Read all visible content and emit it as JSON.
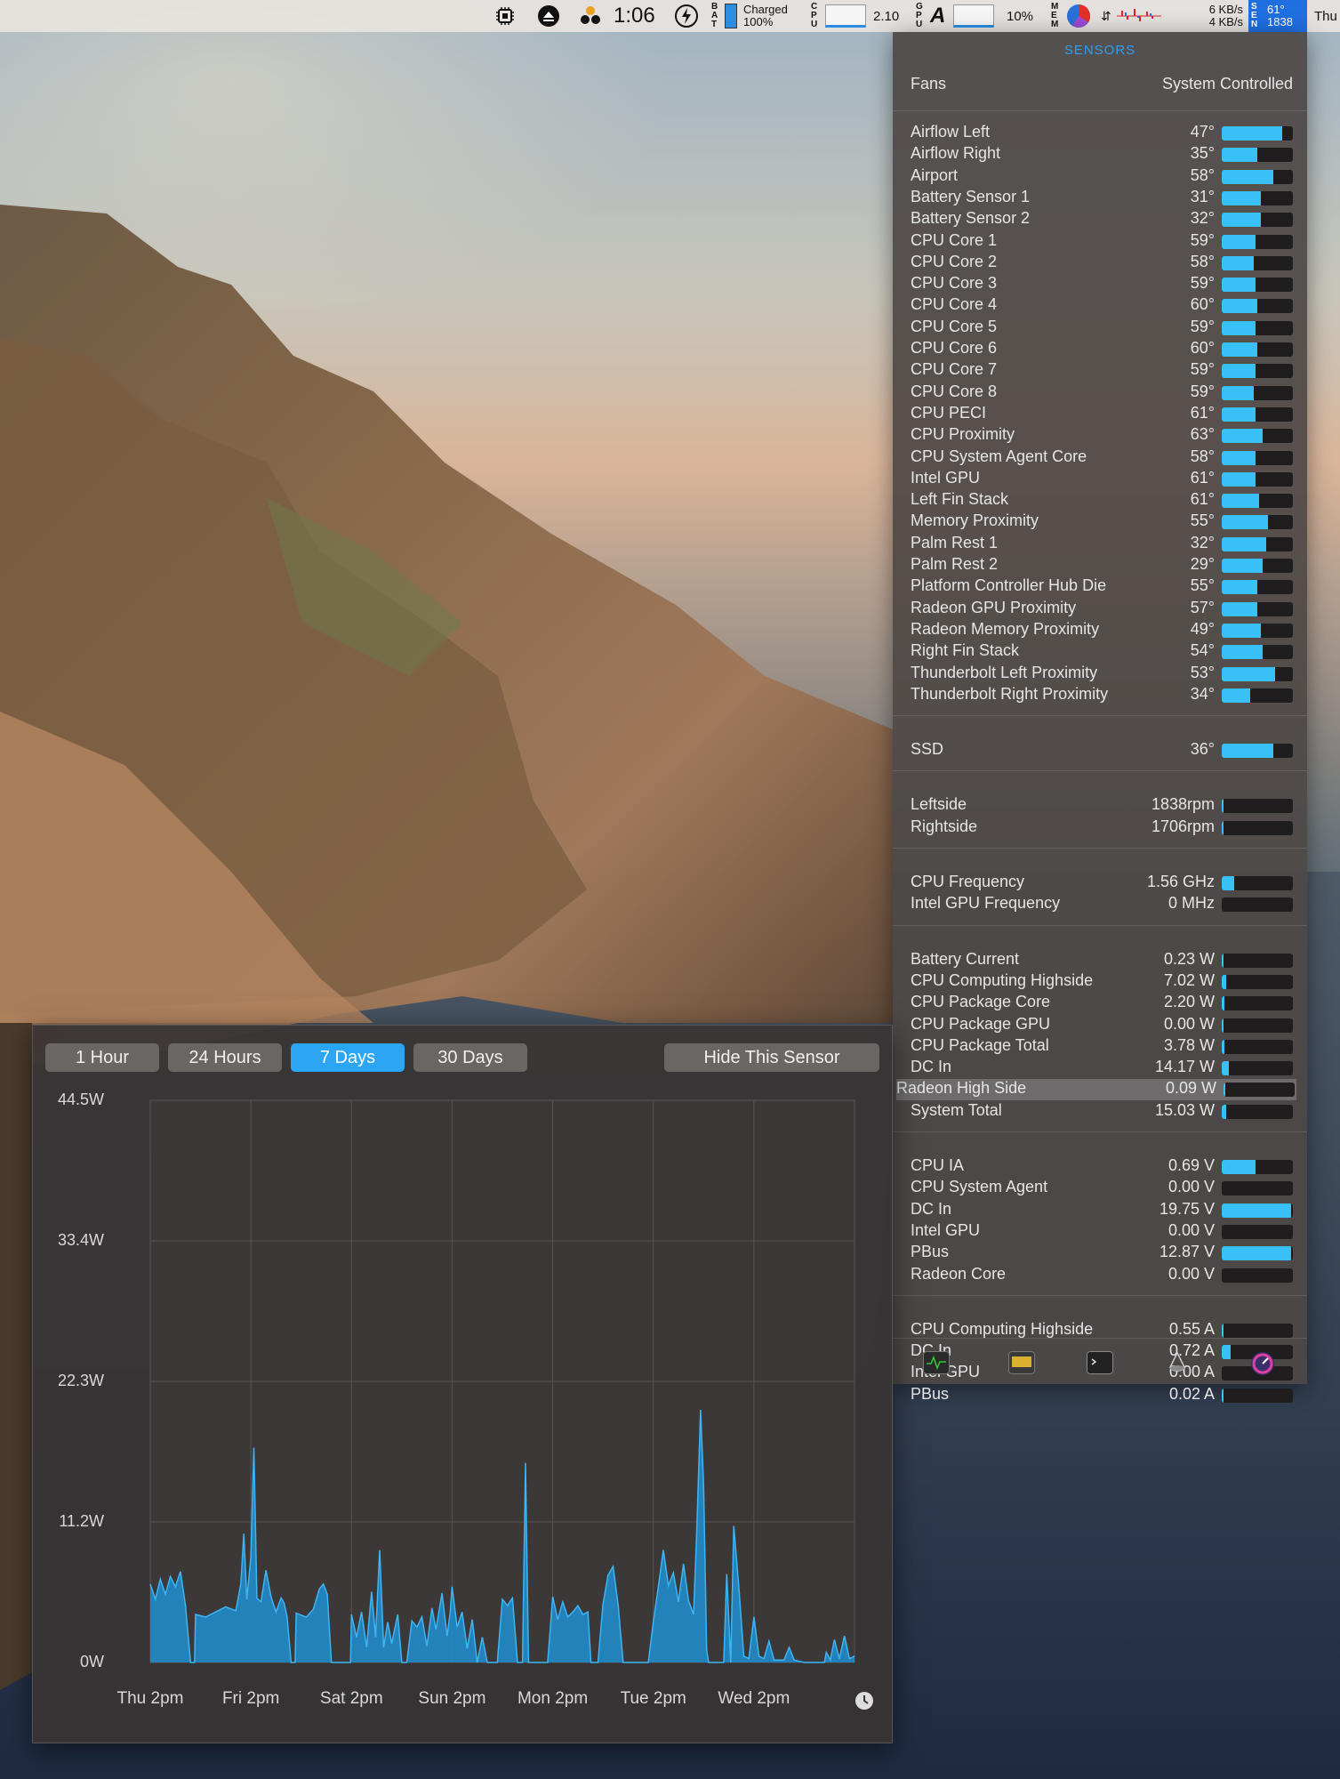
{
  "menubar": {
    "time": "1:06",
    "battery_label": "BAT",
    "battery_status": "Charged",
    "battery_percent": "100%",
    "cpu_label": "CPU",
    "cpu_load": "2.10",
    "gpu_label": "GPU",
    "gpu_percent": "10%",
    "mem_label": "MEM",
    "net_up": "6 KB/s",
    "net_down": "4 KB/s",
    "sensor_label": "SEN",
    "sensor_temp": "61°",
    "sensor_rpm": "1838",
    "day": "Thu"
  },
  "panel": {
    "title": "SENSORS",
    "fans_label": "Fans",
    "fans_mode": "System Controlled",
    "temperatures": [
      {
        "label": "Airflow Left",
        "value": "47°",
        "level": 0.85
      },
      {
        "label": "Airflow Right",
        "value": "35°",
        "level": 0.5
      },
      {
        "label": "Airport",
        "value": "58°",
        "level": 0.72
      },
      {
        "label": "Battery Sensor 1",
        "value": "31°",
        "level": 0.55
      },
      {
        "label": "Battery Sensor 2",
        "value": "32°",
        "level": 0.55
      },
      {
        "label": "CPU Core 1",
        "value": "59°",
        "level": 0.48
      },
      {
        "label": "CPU Core 2",
        "value": "58°",
        "level": 0.45
      },
      {
        "label": "CPU Core 3",
        "value": "59°",
        "level": 0.48
      },
      {
        "label": "CPU Core 4",
        "value": "60°",
        "level": 0.5
      },
      {
        "label": "CPU Core 5",
        "value": "59°",
        "level": 0.48
      },
      {
        "label": "CPU Core 6",
        "value": "60°",
        "level": 0.5
      },
      {
        "label": "CPU Core 7",
        "value": "59°",
        "level": 0.48
      },
      {
        "label": "CPU Core 8",
        "value": "59°",
        "level": 0.45
      },
      {
        "label": "CPU PECI",
        "value": "61°",
        "level": 0.48
      },
      {
        "label": "CPU Proximity",
        "value": "63°",
        "level": 0.58
      },
      {
        "label": "CPU System Agent Core",
        "value": "58°",
        "level": 0.48
      },
      {
        "label": "Intel GPU",
        "value": "61°",
        "level": 0.48
      },
      {
        "label": "Left Fin Stack",
        "value": "61°",
        "level": 0.52
      },
      {
        "label": "Memory Proximity",
        "value": "55°",
        "level": 0.65
      },
      {
        "label": "Palm Rest 1",
        "value": "32°",
        "level": 0.62
      },
      {
        "label": "Palm Rest 2",
        "value": "29°",
        "level": 0.58
      },
      {
        "label": "Platform Controller Hub Die",
        "value": "55°",
        "level": 0.5
      },
      {
        "label": "Radeon GPU Proximity",
        "value": "57°",
        "level": 0.5
      },
      {
        "label": "Radeon Memory Proximity",
        "value": "49°",
        "level": 0.55
      },
      {
        "label": "Right Fin Stack",
        "value": "54°",
        "level": 0.58
      },
      {
        "label": "Thunderbolt Left Proximity",
        "value": "53°",
        "level": 0.75
      },
      {
        "label": "Thunderbolt Right Proximity",
        "value": "34°",
        "level": 0.4
      }
    ],
    "ssd": [
      {
        "label": "SSD",
        "value": "36°",
        "level": 0.72
      }
    ],
    "fans": [
      {
        "label": "Leftside",
        "value": "1838rpm",
        "level": 0.02
      },
      {
        "label": "Rightside",
        "value": "1706rpm",
        "level": 0.02
      }
    ],
    "frequencies": [
      {
        "label": "CPU Frequency",
        "value": "1.56 GHz",
        "level": 0.18
      },
      {
        "label": "Intel GPU Frequency",
        "value": "0 MHz",
        "level": 0.0
      }
    ],
    "power": [
      {
        "label": "Battery Current",
        "value": "0.23 W",
        "level": 0.02
      },
      {
        "label": "CPU Computing Highside",
        "value": "7.02 W",
        "level": 0.06
      },
      {
        "label": "CPU Package Core",
        "value": "2.20 W",
        "level": 0.04
      },
      {
        "label": "CPU Package GPU",
        "value": "0.00 W",
        "level": 0.02
      },
      {
        "label": "CPU Package Total",
        "value": "3.78 W",
        "level": 0.04
      },
      {
        "label": "DC In",
        "value": "14.17 W",
        "level": 0.1
      },
      {
        "label": "Radeon High Side",
        "value": "0.09 W",
        "level": 0.02,
        "highlight": true
      },
      {
        "label": "System Total",
        "value": "15.03 W",
        "level": 0.06
      }
    ],
    "voltages": [
      {
        "label": "CPU IA",
        "value": "0.69 V",
        "level": 0.48
      },
      {
        "label": "CPU System Agent",
        "value": "0.00 V",
        "level": 0.0
      },
      {
        "label": "DC In",
        "value": "19.75 V",
        "level": 0.98
      },
      {
        "label": "Intel GPU",
        "value": "0.00 V",
        "level": 0.0
      },
      {
        "label": "PBus",
        "value": "12.87 V",
        "level": 0.98
      },
      {
        "label": "Radeon Core",
        "value": "0.00 V",
        "level": 0.0
      }
    ],
    "currents": [
      {
        "label": "CPU Computing Highside",
        "value": "0.55 A",
        "level": 0.03
      },
      {
        "label": "DC In",
        "value": "0.72 A",
        "level": 0.12
      },
      {
        "label": "Intel GPU",
        "value": "0.00 A",
        "level": 0.0
      },
      {
        "label": "PBus",
        "value": "0.02 A",
        "level": 0.02
      }
    ],
    "dock_icons": [
      "activity-monitor-icon",
      "console-icon",
      "terminal-icon",
      "disk-utility-icon",
      "istat-icon"
    ]
  },
  "chart_window": {
    "buttons": [
      "1 Hour",
      "24 Hours",
      "7 Days",
      "30 Days"
    ],
    "active_button": "7 Days",
    "hide_button": "Hide This Sensor"
  },
  "chart_data": {
    "type": "area",
    "title": "",
    "y_ticks": [
      "44.5W",
      "33.4W",
      "22.3W",
      "11.2W",
      "0W"
    ],
    "ylim": [
      0,
      44.5
    ],
    "x_ticks": [
      "Thu 2pm",
      "Fri 2pm",
      "Sat 2pm",
      "Sun 2pm",
      "Mon 2pm",
      "Tue 2pm",
      "Wed 2pm"
    ],
    "xlim": [
      0,
      7
    ],
    "grid": true,
    "series": [
      {
        "color": "#1f8fd0",
        "points": [
          [
            0,
            6.2
          ],
          [
            0.05,
            5.0
          ],
          [
            0.1,
            6.6
          ],
          [
            0.15,
            5.4
          ],
          [
            0.2,
            6.8
          ],
          [
            0.25,
            6.0
          ],
          [
            0.3,
            7.2
          ],
          [
            0.35,
            4.5
          ],
          [
            0.4,
            0
          ],
          [
            0.44,
            0
          ],
          [
            0.45,
            3.8
          ],
          [
            0.55,
            3.6
          ],
          [
            0.65,
            4.0
          ],
          [
            0.75,
            4.4
          ],
          [
            0.85,
            4.1
          ],
          [
            0.9,
            6.2
          ],
          [
            0.93,
            10.2
          ],
          [
            0.96,
            5.0
          ],
          [
            1.0,
            8.3
          ],
          [
            1.03,
            17.0
          ],
          [
            1.06,
            5.1
          ],
          [
            1.1,
            4.8
          ],
          [
            1.15,
            7.3
          ],
          [
            1.2,
            5.2
          ],
          [
            1.25,
            4.0
          ],
          [
            1.3,
            5.1
          ],
          [
            1.33,
            4.7
          ],
          [
            1.36,
            3.6
          ],
          [
            1.4,
            0
          ],
          [
            1.44,
            0
          ],
          [
            1.45,
            3.9
          ],
          [
            1.55,
            3.6
          ],
          [
            1.62,
            4.2
          ],
          [
            1.68,
            5.8
          ],
          [
            1.72,
            6.2
          ],
          [
            1.76,
            5.4
          ],
          [
            1.8,
            0
          ],
          [
            1.99,
            0
          ],
          [
            2.0,
            3.8
          ],
          [
            2.05,
            2.0
          ],
          [
            2.1,
            4.0
          ],
          [
            2.15,
            1.2
          ],
          [
            2.2,
            5.6
          ],
          [
            2.24,
            2.0
          ],
          [
            2.28,
            8.9
          ],
          [
            2.32,
            1.2
          ],
          [
            2.36,
            3.2
          ],
          [
            2.4,
            1.5
          ],
          [
            2.46,
            3.8
          ],
          [
            2.5,
            0
          ],
          [
            2.55,
            0
          ],
          [
            2.6,
            3.3
          ],
          [
            2.65,
            2.8
          ],
          [
            2.7,
            3.6
          ],
          [
            2.75,
            1.3
          ],
          [
            2.8,
            4.3
          ],
          [
            2.84,
            2.6
          ],
          [
            2.9,
            5.5
          ],
          [
            2.95,
            2.1
          ],
          [
            2.98,
            3.9
          ],
          [
            3.0,
            6.0
          ],
          [
            3.05,
            2.8
          ],
          [
            3.1,
            4.0
          ],
          [
            3.15,
            1.1
          ],
          [
            3.2,
            3.4
          ],
          [
            3.25,
            0
          ],
          [
            3.3,
            2.0
          ],
          [
            3.35,
            0
          ],
          [
            3.45,
            0
          ],
          [
            3.5,
            5.0
          ],
          [
            3.55,
            4.5
          ],
          [
            3.6,
            5.1
          ],
          [
            3.65,
            0
          ],
          [
            3.7,
            0
          ],
          [
            3.73,
            15.8
          ],
          [
            3.76,
            0
          ],
          [
            3.95,
            0
          ],
          [
            4.0,
            5.2
          ],
          [
            4.05,
            3.4
          ],
          [
            4.1,
            4.8
          ],
          [
            4.15,
            3.6
          ],
          [
            4.2,
            4.0
          ],
          [
            4.25,
            4.5
          ],
          [
            4.3,
            3.8
          ],
          [
            4.35,
            4.0
          ],
          [
            4.38,
            0
          ],
          [
            4.45,
            0
          ],
          [
            4.5,
            4.6
          ],
          [
            4.55,
            6.9
          ],
          [
            4.6,
            7.6
          ],
          [
            4.65,
            4.6
          ],
          [
            4.7,
            0
          ],
          [
            4.95,
            0
          ],
          [
            5.0,
            3.2
          ],
          [
            5.05,
            6.0
          ],
          [
            5.1,
            8.9
          ],
          [
            5.15,
            6.1
          ],
          [
            5.2,
            7.1
          ],
          [
            5.25,
            4.8
          ],
          [
            5.3,
            7.8
          ],
          [
            5.35,
            4.9
          ],
          [
            5.4,
            3.8
          ],
          [
            5.43,
            10.0
          ],
          [
            5.47,
            20.0
          ],
          [
            5.5,
            14.0
          ],
          [
            5.53,
            1.0
          ],
          [
            5.55,
            0
          ],
          [
            5.7,
            0
          ],
          [
            5.73,
            7.0
          ],
          [
            5.77,
            0
          ],
          [
            5.8,
            10.8
          ],
          [
            5.85,
            6.0
          ],
          [
            5.9,
            0.5
          ],
          [
            5.95,
            0.3
          ],
          [
            6.0,
            3.6
          ],
          [
            6.05,
            0.5
          ],
          [
            6.1,
            0.3
          ],
          [
            6.15,
            1.7
          ],
          [
            6.2,
            0.2
          ],
          [
            6.3,
            0.2
          ],
          [
            6.35,
            1.2
          ],
          [
            6.4,
            0.2
          ],
          [
            6.5,
            0
          ],
          [
            6.7,
            0
          ],
          [
            6.72,
            0.8
          ],
          [
            6.76,
            0.2
          ],
          [
            6.8,
            1.8
          ],
          [
            6.85,
            0.3
          ],
          [
            6.9,
            2.1
          ],
          [
            6.95,
            0.3
          ],
          [
            7.0,
            0.5
          ]
        ]
      }
    ]
  }
}
